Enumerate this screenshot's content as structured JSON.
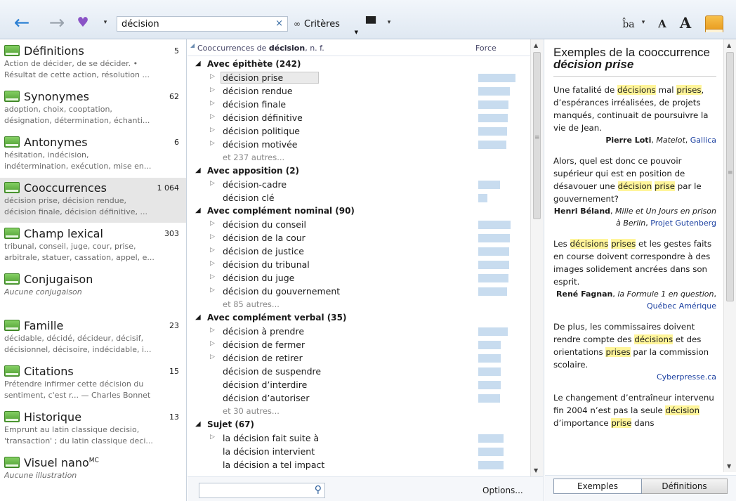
{
  "toolbar": {
    "back_icon": "←",
    "forward_icon": "→",
    "favorite_icon": "♥",
    "caret": "▾",
    "search_value": "décision",
    "clear_icon": "×",
    "criteria_icon": "∞",
    "criteria_label": "Critères",
    "criteria_caret": "▼",
    "hat_icon": "▀",
    "translate_label": "b̂a",
    "font_small": "A",
    "font_large": "A"
  },
  "sidebar": {
    "items": [
      {
        "title": "Définitions",
        "count": "5",
        "sub1": "Action de décider, de se décider. •",
        "sub2": "Résultat de cette action, résolution ..."
      },
      {
        "title": "Synonymes",
        "count": "62",
        "sub1": "adoption, choix, cooptation,",
        "sub2": "désignation, détermination, échanti..."
      },
      {
        "title": "Antonymes",
        "count": "6",
        "sub1": "hésitation, indécision,",
        "sub2": "indétermination, exécution, mise en..."
      },
      {
        "title": "Cooccurrences",
        "count": "1 064",
        "sub1": "décision prise, décision rendue,",
        "sub2": "décision finale, décision définitive, ..."
      },
      {
        "title": "Champ lexical",
        "count": "303",
        "sub1": "tribunal, conseil, juge, cour, prise,",
        "sub2": "arbitrale, statuer, cassation, appel, e..."
      },
      {
        "title": "Conjugaison",
        "count": "",
        "sub1": "Aucune conjugaison",
        "sub2": ""
      },
      {
        "title": "Famille",
        "count": "23",
        "sub1": "décidable, décidé, décideur, décisif,",
        "sub2": "décisionnel, décisoire, indécidable, i..."
      },
      {
        "title": "Citations",
        "count": "15",
        "sub1": "Prétendre infirmer cette décision du",
        "sub2": "sentiment, c'est r... — Charles Bonnet"
      },
      {
        "title": "Historique",
        "count": "13",
        "sub1": "Emprunt au latin classique decisio,",
        "sub2": "'transaction' ; du latin classique deci..."
      },
      {
        "title": "Visuel nano",
        "title_sup": "MC",
        "count": "",
        "sub1": "Aucune illustration",
        "sub2": ""
      }
    ]
  },
  "middle": {
    "header_prefix": "Cooccurrences de ",
    "header_word": "décision",
    "header_suffix": ", n. f.",
    "force_label": "Force",
    "group_arrow": "◢",
    "item_arrow": "▷",
    "rows": [
      {
        "kind": "group",
        "label": "Avec épithète (242)"
      },
      {
        "kind": "item",
        "label": "décision prise",
        "arrow": true,
        "force": 0.95,
        "selected": true
      },
      {
        "kind": "item",
        "label": "décision rendue",
        "arrow": true,
        "force": 0.8
      },
      {
        "kind": "item",
        "label": "décision finale",
        "arrow": true,
        "force": 0.77
      },
      {
        "kind": "item",
        "label": "décision définitive",
        "arrow": true,
        "force": 0.75
      },
      {
        "kind": "item",
        "label": "décision politique",
        "arrow": true,
        "force": 0.74
      },
      {
        "kind": "item",
        "label": "décision motivée",
        "arrow": true,
        "force": 0.72
      },
      {
        "kind": "more",
        "label": "et 237 autres..."
      },
      {
        "kind": "group",
        "label": "Avec apposition (2)"
      },
      {
        "kind": "item",
        "label": "décision-cadre",
        "arrow": true,
        "force": 0.55
      },
      {
        "kind": "item",
        "label": "décision clé",
        "arrow": false,
        "force": 0.23
      },
      {
        "kind": "group",
        "label": "Avec complément nominal (90)"
      },
      {
        "kind": "item",
        "label": "décision du conseil",
        "arrow": true,
        "force": 0.82
      },
      {
        "kind": "item",
        "label": "décision de la cour",
        "arrow": true,
        "force": 0.8
      },
      {
        "kind": "item",
        "label": "décision de justice",
        "arrow": true,
        "force": 0.79
      },
      {
        "kind": "item",
        "label": "décision du tribunal",
        "arrow": true,
        "force": 0.78
      },
      {
        "kind": "item",
        "label": "décision du juge",
        "arrow": true,
        "force": 0.76
      },
      {
        "kind": "item",
        "label": "décision du gouvernement",
        "arrow": true,
        "force": 0.73
      },
      {
        "kind": "more",
        "label": "et 85 autres..."
      },
      {
        "kind": "group",
        "label": "Avec complément verbal (35)"
      },
      {
        "kind": "item",
        "label": "décision à prendre",
        "arrow": true,
        "force": 0.75
      },
      {
        "kind": "item",
        "label": "décision de fermer",
        "arrow": true,
        "force": 0.58
      },
      {
        "kind": "item",
        "label": "décision de retirer",
        "arrow": true,
        "force": 0.58
      },
      {
        "kind": "item",
        "label": "décision de suspendre",
        "arrow": false,
        "force": 0.57
      },
      {
        "kind": "item",
        "label": "décision d’interdire",
        "arrow": false,
        "force": 0.57
      },
      {
        "kind": "item",
        "label": "décision d’autoriser",
        "arrow": false,
        "force": 0.56
      },
      {
        "kind": "more",
        "label": "et 30 autres..."
      },
      {
        "kind": "group",
        "label": "Sujet (67)"
      },
      {
        "kind": "item",
        "label": "la décision fait suite à",
        "arrow": true,
        "force": 0.65
      },
      {
        "kind": "item",
        "label": "la décision intervient",
        "arrow": false,
        "force": 0.65
      },
      {
        "kind": "item",
        "label": "la décision a tel impact",
        "arrow": false,
        "force": 0.65
      }
    ],
    "options_label": "Options...",
    "filter_value": "",
    "filter_icon": "⚲"
  },
  "right": {
    "title_line": "Exemples de la cooccurrence ",
    "title_term": "décision prise",
    "tabs": [
      "Exemples",
      "Définitions"
    ],
    "examples": [
      {
        "html": "Une fatalité de <span class='hl'>décisions</span> mal <span class='hl'>prises</span>, d’espérances irréalisées, de projets manqués, continuait de poursuivre la vie de Jean.",
        "author": "Pierre Loti",
        "work": "Matelot",
        "source": "Gallica"
      },
      {
        "html": "Alors, quel est donc ce pouvoir supérieur qui est en position de désavouer une <span class='hl'>décision</span> <span class='hl'>prise</span> par le gouvernement?",
        "author": "Henri Béland",
        "work": "Mille et Un Jours en prison à Berlin",
        "source": "Projet Gutenberg"
      },
      {
        "html": "Les <span class='hl'>décisions</span> <span class='hl'>prises</span> et les gestes faits en course doivent correspondre à des images solidement ancrées dans son esprit.",
        "author": "René Fagnan",
        "work": "la Formule 1 en question",
        "source": "Québec Amérique"
      },
      {
        "html": "De plus, les commissaires doivent rendre compte des <span class='hl'>décisions</span> et des orientations <span class='hl'>prises</span> par la commission scolaire.",
        "author": "",
        "work": "",
        "source": "Cyberpresse.ca"
      },
      {
        "html": "Le changement d’entraîneur intervenu fin 2004 n’est pas la seule <span class='hl'>décision</span> d’importance <span class='hl'>prise</span> dans",
        "author": "",
        "work": "",
        "source": ""
      }
    ]
  },
  "scroll": {
    "up": "▲",
    "down": "▼",
    "grip": "≡"
  }
}
